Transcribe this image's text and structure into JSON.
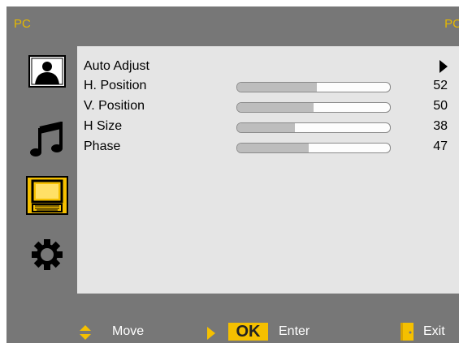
{
  "header": {
    "left": "PC",
    "right": "PC"
  },
  "sidebar": [
    {
      "name": "picture-icon",
      "selected": false
    },
    {
      "name": "music-note-icon",
      "selected": false
    },
    {
      "name": "monitor-keyboard-icon",
      "selected": true
    },
    {
      "name": "gear-icon",
      "selected": false
    }
  ],
  "menu": {
    "auto_adjust": "Auto Adjust",
    "items": [
      {
        "label": "H. Position",
        "value": "52"
      },
      {
        "label": "V. Position",
        "value": "50"
      },
      {
        "label": "H Size",
        "value": "38"
      },
      {
        "label": "Phase",
        "value": "47"
      }
    ]
  },
  "footer": {
    "move": "Move",
    "ok": "OK",
    "enter": "Enter",
    "exit": "Exit"
  },
  "colors": {
    "accent": "#f5c000",
    "header_text": "#e6b800",
    "background": "#777777",
    "panel": "#e5e5e5"
  }
}
